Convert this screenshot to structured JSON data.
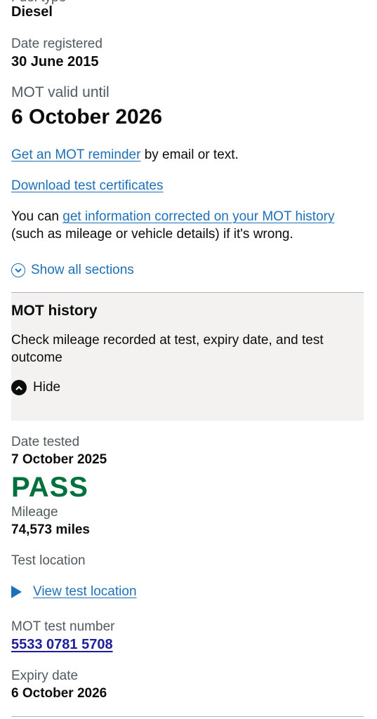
{
  "vehicle": {
    "fuel_type_label": "Fuel type",
    "fuel_type_value": "Diesel",
    "date_registered_label": "Date registered",
    "date_registered_value": "30 June 2015",
    "mot_valid_label": "MOT valid until",
    "mot_valid_value": "6 October 2026"
  },
  "links": {
    "reminder_link": "Get an MOT reminder",
    "reminder_suffix": " by email or text.",
    "download_link": "Download test certificates",
    "correction_prefix": "You can ",
    "correction_link": "get information corrected on your MOT history",
    "correction_suffix": "(such as mileage or vehicle details) if it's wrong."
  },
  "accordion": {
    "show_all_label": "Show all sections",
    "section_title": "MOT history",
    "section_summary": "Check mileage recorded at test, expiry date, and test outcome",
    "hide_label": "Hide"
  },
  "test": {
    "date_tested_label": "Date tested",
    "date_tested_value": "7 October 2025",
    "result": "PASS",
    "mileage_label": "Mileage",
    "mileage_value": "74,573 miles",
    "location_label": "Test location",
    "view_location_link": "View test location",
    "test_number_label": "MOT test number",
    "test_number_value": "5533 0781 5708",
    "expiry_label": "Expiry date",
    "expiry_value": "6 October 2026"
  },
  "colors": {
    "link": "#1d70b8",
    "pass": "#00703c",
    "panel_bg": "#f3f2f1"
  },
  "icons": [
    "chevron-down-circle-icon",
    "chevron-up-circle-icon",
    "triangle-right-icon"
  ]
}
